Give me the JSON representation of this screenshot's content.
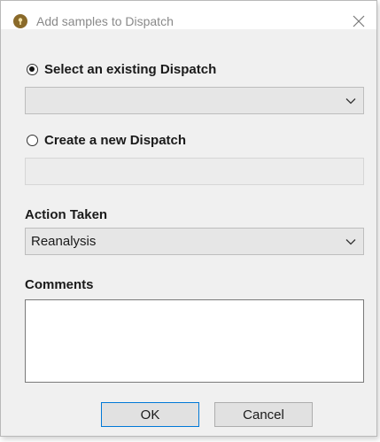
{
  "dialog": {
    "title": "Add samples to Dispatch",
    "icons": {
      "app": "key-badge-icon",
      "close": "close-icon"
    }
  },
  "existing_dispatch": {
    "label": "Select an existing Dispatch",
    "selected": true,
    "value": ""
  },
  "new_dispatch": {
    "label": "Create a new Dispatch",
    "selected": false,
    "value": ""
  },
  "action_taken": {
    "label": "Action Taken",
    "value": "Reanalysis"
  },
  "comments": {
    "label": "Comments",
    "value": ""
  },
  "buttons": {
    "ok": "OK",
    "cancel": "Cancel"
  },
  "colors": {
    "accent": "#0078d7",
    "dialog_bg": "#f0f0f0",
    "icon_brown": "#8a6a2a"
  }
}
